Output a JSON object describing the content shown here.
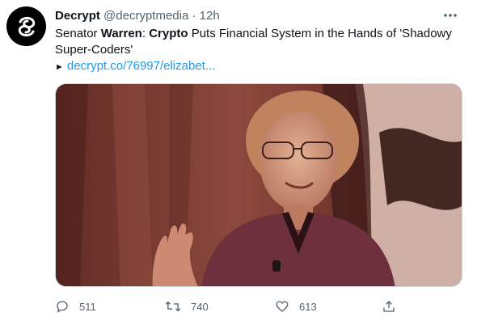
{
  "tweet": {
    "display_name": "Decrypt",
    "handle": "@decryptmedia",
    "separator": "·",
    "time": "12h",
    "text_parts": {
      "p1": "Senator ",
      "b1": "Warren",
      "p2": ": ",
      "b2": "Crypto",
      "p3": " Puts Financial System in the Hands of 'Shadowy Super-Coders'"
    },
    "link_arrow": "►",
    "link_text": "decrypt.co/76997/elizabet...",
    "more_icon": "more-horizontal-icon"
  },
  "actions": {
    "reply_count": "511",
    "retweet_count": "740",
    "like_count": "613"
  },
  "colors": {
    "accent_link": "#1d9bf0",
    "muted": "#536471",
    "text": "#0f1419",
    "photo_tint": "#7a3a33"
  }
}
